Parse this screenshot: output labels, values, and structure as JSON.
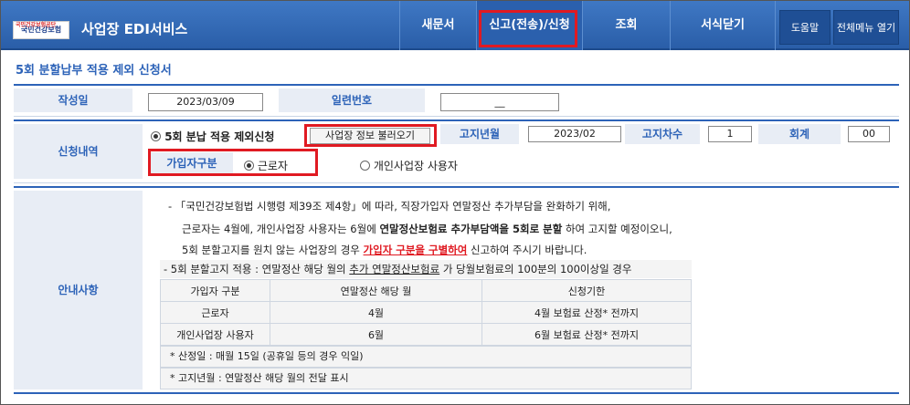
{
  "header": {
    "logo_small": "국민건강보험공단",
    "logo_text": "국민건강보험",
    "app_title": "사업장 EDI서비스",
    "nav": [
      "새문서",
      "신고(전송)/신청",
      "조회",
      "서식닫기"
    ],
    "help": "도움말",
    "all_menu": "전체메뉴 열기"
  },
  "page_title": "5회 분할납부 적용 제외 신청서",
  "form": {
    "write_date_label": "작성일",
    "write_date": "2023/03/09",
    "serial_label": "일련번호",
    "serial_value": "__",
    "apply_label": "신청내역",
    "option_exclude": "5회 분납 적용 제외신청",
    "load_button": "사업장 정보 불러오기",
    "notice_ym_label": "고지년월",
    "notice_ym": "2023/02",
    "notice_count_label": "고지차수",
    "notice_count": "1",
    "account_label": "회계",
    "account": "00",
    "subscriber_type_label": "가입자구분",
    "type_worker": "근로자",
    "type_self": "개인사업장 사용자"
  },
  "guide": {
    "label": "안내사항",
    "line1": "- 「국민건강보험법 시행령 제39조 제4항」에 따라, 직장가입자 연말정산 추가부담을 완화하기 위해,",
    "line2_a": "근로자는 4월에, 개인사업장 사용자는 6월에 ",
    "line2_b": "연말정산보험료 추가부담액을 5회로 분할",
    "line2_c": " 하여 고지할 예정이오니,",
    "line3_a": "5회 분할고지를 원치 않는 사업장의 경우 ",
    "line3_b": "가입자 구분을 구별하여",
    "line3_c": " 신고하여 주시기 바랍니다.",
    "sub_a": "- 5회 분할고지 적용 : 연말정산 해당 월의 ",
    "sub_b": "추가 연말정산보험료",
    "sub_c": " 가  당월보험료의 100분의 100이상일 경우",
    "table_headers": [
      "가입자 구분",
      "연말정산 해당 월",
      "신청기한"
    ],
    "table_rows": [
      [
        "근로자",
        "4월",
        "4월 보험료 산정* 전까지"
      ],
      [
        "개인사업장 사용자",
        "6월",
        "6월 보험료 산정* 전까지"
      ]
    ],
    "note1": "* 산정일 : 매월 15일 (공휴일 등의 경우 익일)",
    "note2": "* 고지년월 : 연말정산 해당 월의 전달 표시"
  }
}
